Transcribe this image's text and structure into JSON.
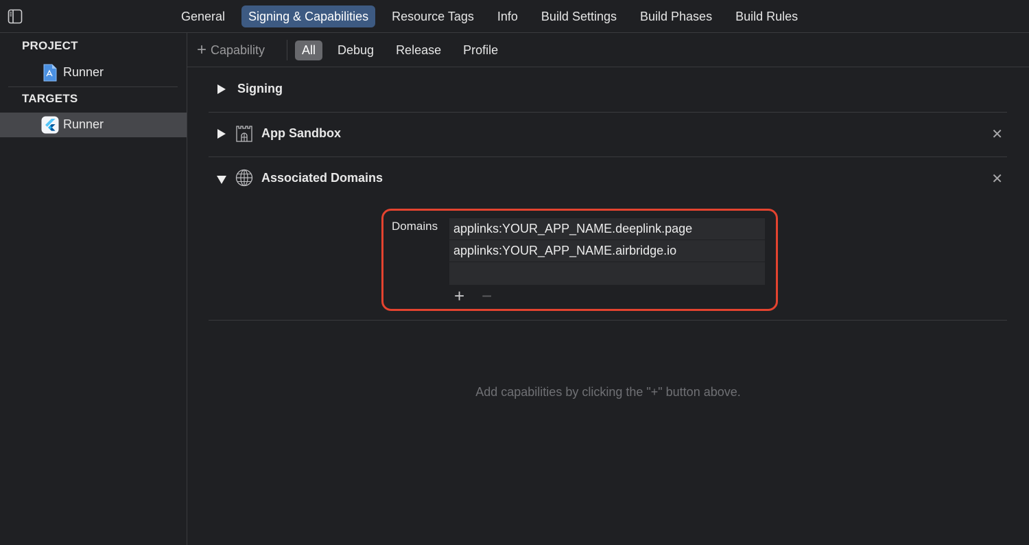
{
  "tabs": [
    {
      "label": "General",
      "active": false
    },
    {
      "label": "Signing & Capabilities",
      "active": true
    },
    {
      "label": "Resource Tags",
      "active": false
    },
    {
      "label": "Info",
      "active": false
    },
    {
      "label": "Build Settings",
      "active": false
    },
    {
      "label": "Build Phases",
      "active": false
    },
    {
      "label": "Build Rules",
      "active": false
    }
  ],
  "sidebar": {
    "project_header": "PROJECT",
    "project_item": "Runner",
    "targets_header": "TARGETS",
    "target_item": "Runner"
  },
  "toolbar": {
    "add_capability": "Capability",
    "filters": [
      {
        "label": "All",
        "active": true
      },
      {
        "label": "Debug",
        "active": false
      },
      {
        "label": "Release",
        "active": false
      },
      {
        "label": "Profile",
        "active": false
      }
    ]
  },
  "sections": {
    "signing": {
      "title": "Signing",
      "expanded": false
    },
    "sandbox": {
      "title": "App Sandbox",
      "expanded": false,
      "remove": "✕"
    },
    "domains": {
      "title": "Associated Domains",
      "expanded": true,
      "remove": "✕"
    }
  },
  "associated_domains": {
    "label": "Domains",
    "entries": [
      "applinks:YOUR_APP_NAME.deeplink.page",
      "applinks:YOUR_APP_NAME.airbridge.io"
    ],
    "add_symbol": "+",
    "remove_symbol": "−"
  },
  "hint": "Add capabilities by clicking the \"+\" button above.",
  "colors": {
    "background": "#1f2023",
    "active_tab": "#3d5a82",
    "highlight_box": "#e4432f"
  },
  "icons": {
    "sidebar_toggle": "sidebar-toggle-icon",
    "project": "xcode-project-icon",
    "target": "flutter-app-icon",
    "sandbox": "castle-icon",
    "domains": "globe-icon"
  }
}
